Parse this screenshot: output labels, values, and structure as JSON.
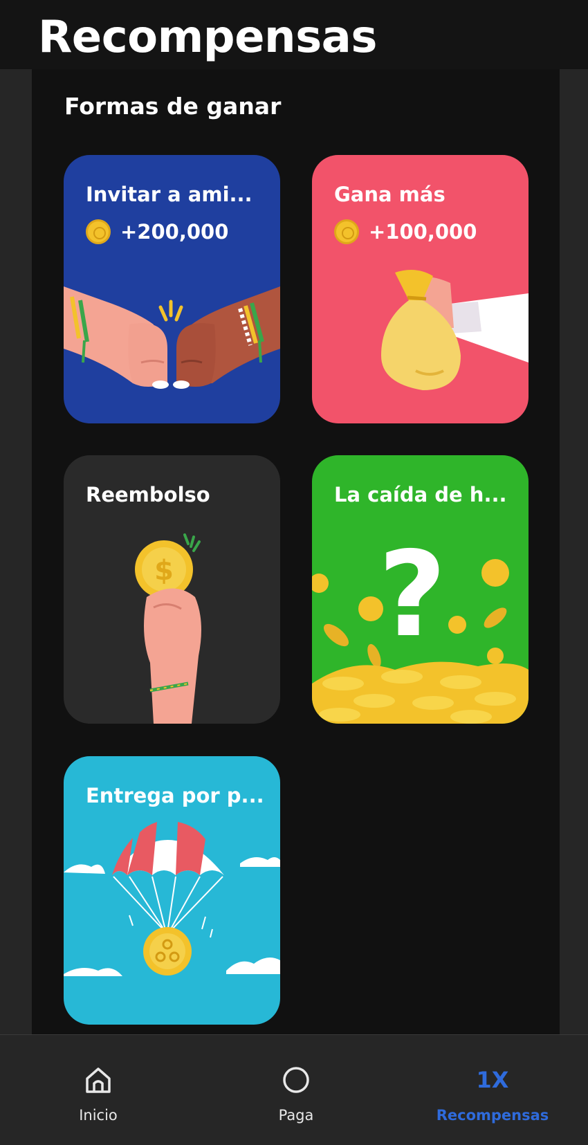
{
  "header": {
    "title": "Recompensas"
  },
  "section": {
    "title": "Formas de ganar"
  },
  "cards": [
    {
      "title": "Invitar a ami...",
      "reward": "+200,000",
      "coin_icon": "coin-icon",
      "color": "#1f3f9f"
    },
    {
      "title": "Gana más",
      "reward": "+100,000",
      "coin_icon": "coin-icon",
      "color": "#f2536a"
    },
    {
      "title": "Reembolso",
      "color": "#2a2a2a"
    },
    {
      "title": "La caída de h...",
      "color": "#2fb52a"
    },
    {
      "title": "Entrega por p...",
      "color": "#27b8d6"
    }
  ],
  "nav": {
    "items": [
      {
        "label": "Inicio",
        "icon": "home-icon"
      },
      {
        "label": "Paga",
        "icon": "circle-icon"
      },
      {
        "label": "Recompensas",
        "icon_text": "1X",
        "active": true
      }
    ],
    "accent": "#2f6bdc"
  }
}
